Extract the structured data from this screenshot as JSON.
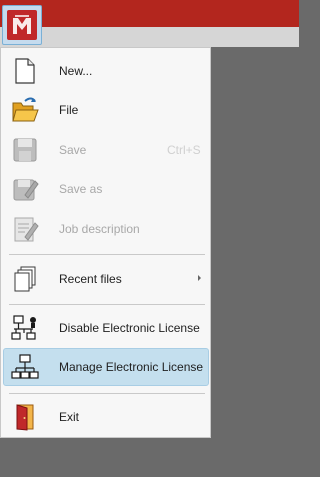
{
  "app": {
    "logo_icon": "nemetschek-style-logo",
    "accent_color": "#b3261e"
  },
  "menu": {
    "items": [
      {
        "label": "New...",
        "icon": "new-document-icon",
        "enabled": true
      },
      {
        "label": "File",
        "icon": "open-folder-icon",
        "enabled": true
      },
      {
        "label": "Save",
        "icon": "floppy-disk-icon",
        "enabled": false,
        "shortcut": "Ctrl+S"
      },
      {
        "label": "Save as",
        "icon": "save-as-icon",
        "enabled": false
      },
      {
        "label": "Job description",
        "icon": "job-description-icon",
        "enabled": false
      },
      {
        "label": "Recent files",
        "icon": "recent-files-icon",
        "enabled": true,
        "submenu": true
      },
      {
        "label": "Disable Electronic License",
        "icon": "network-license-disable-icon",
        "enabled": true
      },
      {
        "label": "Manage Electronic License",
        "icon": "network-license-manage-icon",
        "enabled": true,
        "highlighted": true
      },
      {
        "label": "Exit",
        "icon": "exit-door-icon",
        "enabled": true
      }
    ]
  },
  "colors": {
    "highlight": "#c4dfee",
    "disabled_text": "#a8a8a8"
  }
}
